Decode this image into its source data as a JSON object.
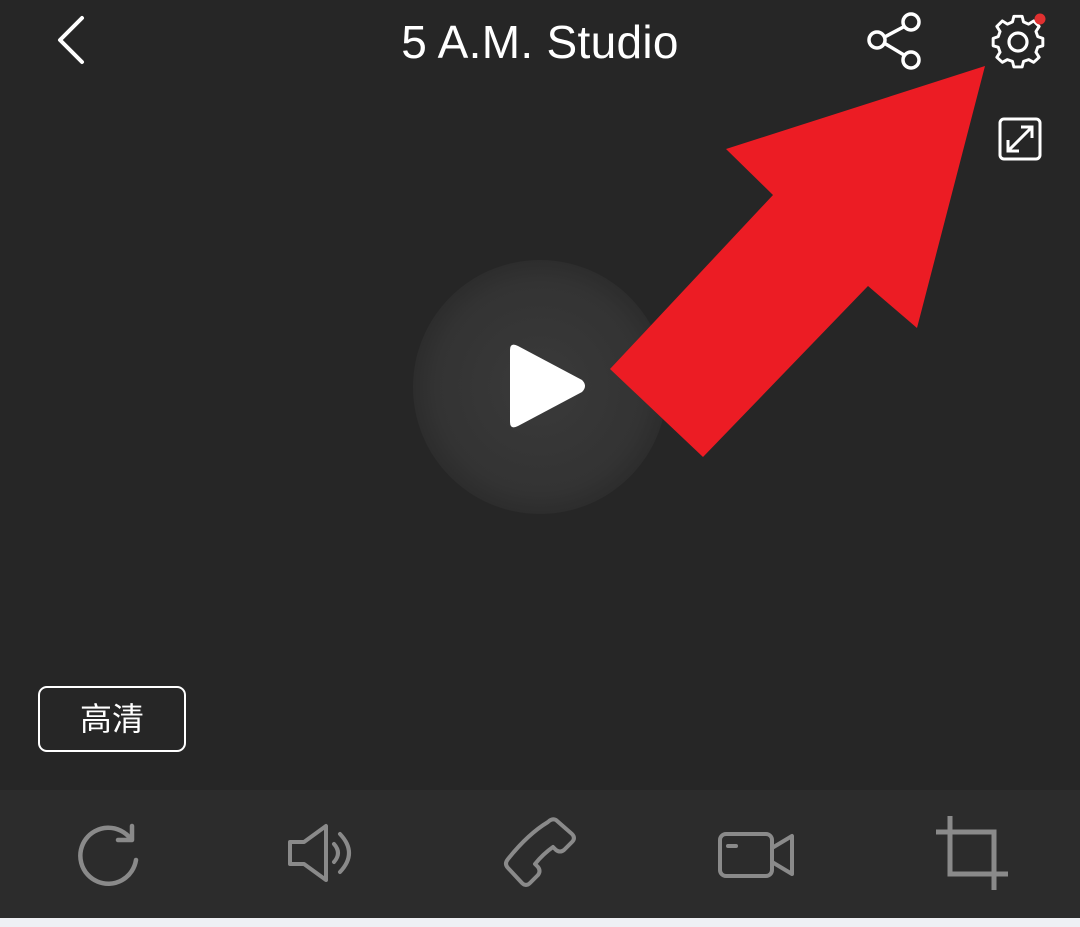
{
  "header": {
    "title": "5 A.M. Studio",
    "back_icon": "chevron-left-icon",
    "share_icon": "share-icon",
    "settings_icon": "gear-icon",
    "settings_badge_color": "#e03030"
  },
  "player": {
    "expand_icon": "expand-icon",
    "play_icon": "play-icon",
    "quality_label": "高清"
  },
  "annotation": {
    "arrow_color": "#ec1c24"
  },
  "toolbar": {
    "items": [
      {
        "name": "refresh",
        "icon": "refresh-icon"
      },
      {
        "name": "speaker",
        "icon": "speaker-icon"
      },
      {
        "name": "call",
        "icon": "phone-icon"
      },
      {
        "name": "record",
        "icon": "video-camera-icon"
      },
      {
        "name": "crop",
        "icon": "crop-icon"
      }
    ]
  }
}
